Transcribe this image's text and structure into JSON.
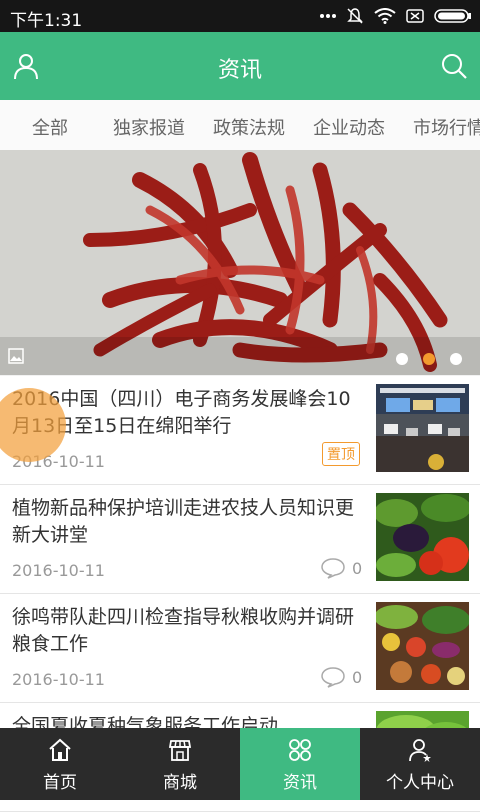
{
  "status_bar": {
    "time": "下午1:31",
    "icons": [
      "dots-icon",
      "mute-icon",
      "wifi-icon",
      "sim-icon",
      "battery-icon"
    ]
  },
  "header": {
    "title": "资讯",
    "left_icon": "user-icon",
    "right_icon": "search-icon"
  },
  "tabs": [
    "全部",
    "独家报道",
    "政策法规",
    "企业动态",
    "市场行情"
  ],
  "banner": {
    "icon": "image-icon",
    "slide_count": 3,
    "active_slide": 2
  },
  "news": [
    {
      "title": "2016中国（四川）电子商务发展峰会10月13日至15日在绵阳举行",
      "date": "2016-10-11",
      "badge": "置顶",
      "comments": "",
      "thumb": "conference"
    },
    {
      "title": "植物新品种保护培训走进农技人员知识更新大讲堂",
      "date": "2016-10-11",
      "badge": "",
      "comments": "0",
      "thumb": "vegetables"
    },
    {
      "title": "徐鸣带队赴四川检查指导秋粮收购并调研粮食工作",
      "date": "2016-10-11",
      "badge": "",
      "comments": "0",
      "thumb": "produce"
    },
    {
      "title": "全国夏收夏种气象服务工作启动",
      "date": "",
      "badge": "",
      "comments": "",
      "thumb": "greens"
    }
  ],
  "nav": [
    {
      "label": "首页",
      "icon": "home-icon"
    },
    {
      "label": "商城",
      "icon": "shop-icon"
    },
    {
      "label": "资讯",
      "icon": "grid-icon"
    },
    {
      "label": "个人中心",
      "icon": "person-icon"
    }
  ],
  "colors": {
    "primary": "#3fba82",
    "accent": "#f39a2e",
    "nav_bg": "#2b2b2b",
    "status_bg": "#161616"
  }
}
